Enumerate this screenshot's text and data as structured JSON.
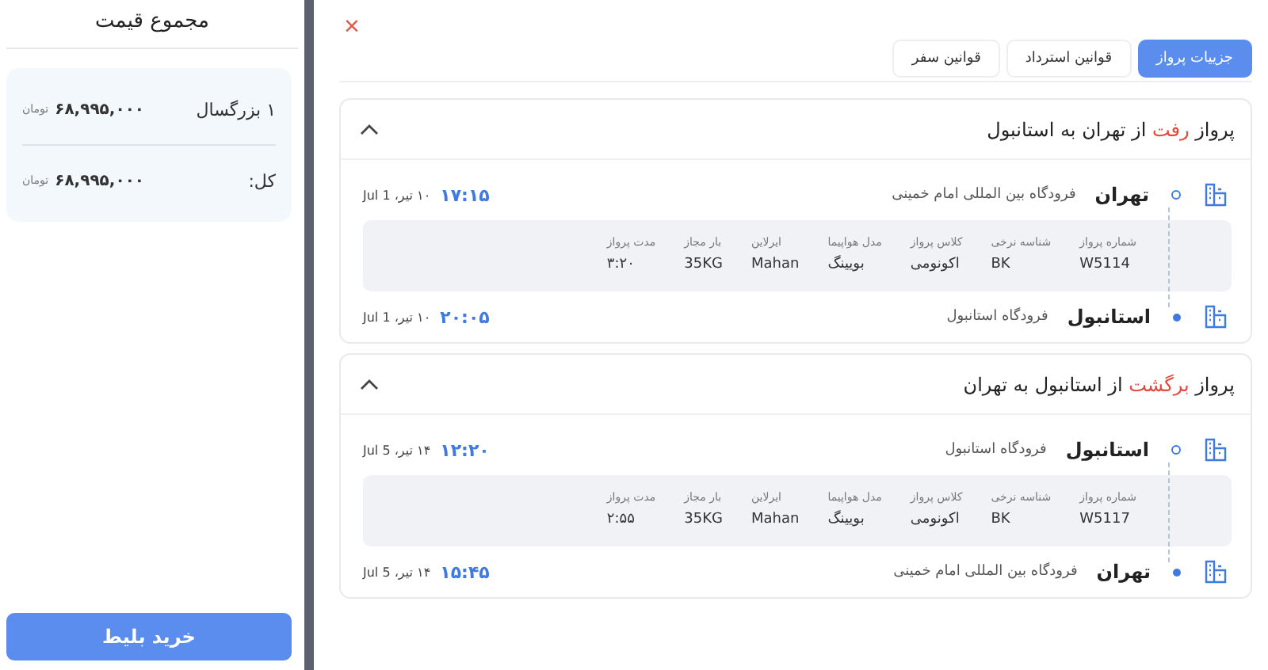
{
  "price_panel": {
    "title": "مجموع قیمت",
    "rows": [
      {
        "label": "۱ بزرگسال",
        "amount": "۶۸,۹۹۵,۰۰۰",
        "currency": "تومان"
      },
      {
        "label": "کل:",
        "amount": "۶۸,۹۹۵,۰۰۰",
        "currency": "تومان"
      }
    ],
    "buy_button": "خرید بلیط"
  },
  "close_button": "×",
  "tabs": [
    {
      "label": "جزییات پرواز",
      "selected": true
    },
    {
      "label": "قوانین استرداد",
      "selected": false
    },
    {
      "label": "قوانین سفر",
      "selected": false
    }
  ],
  "flights": [
    {
      "title": {
        "before": "پرواز",
        "highlight": "رفت",
        "after": "از تهران به استانبول"
      },
      "expanded": true,
      "stops": [
        {
          "kind": "departure",
          "city": "تهران",
          "airport": "فرودگاه بین المللی امام خمینی",
          "time": "۱۷:۱۵",
          "date": "۱۰ تیر، Jul 1"
        },
        {
          "kind": "arrival",
          "city": "استانبول",
          "airport": "فرودگاه استانبول",
          "time": "۲۰:۰۵",
          "date": "۱۰ تیر، Jul 1"
        }
      ],
      "details": [
        {
          "label": "شماره پرواز",
          "value": "W5114"
        },
        {
          "label": "شناسه نرخی",
          "value": "BK"
        },
        {
          "label": "کلاس پرواز",
          "value": "اکونومی"
        },
        {
          "label": "مدل هواپیما",
          "value": "بویینگ"
        },
        {
          "label": "ایرلاین",
          "value": "Mahan"
        },
        {
          "label": "بار مجاز",
          "value": "35KG"
        },
        {
          "label": "مدت پرواز",
          "value": "۳:۲۰"
        }
      ]
    },
    {
      "title": {
        "before": "پرواز",
        "highlight": "برگشت",
        "after": "از استانبول به تهران"
      },
      "expanded": true,
      "stops": [
        {
          "kind": "departure",
          "city": "استانبول",
          "airport": "فرودگاه استانبول",
          "time": "۱۲:۲۰",
          "date": "۱۴ تیر، Jul 5"
        },
        {
          "kind": "arrival",
          "city": "تهران",
          "airport": "فرودگاه بین المللی امام خمینی",
          "time": "۱۵:۴۵",
          "date": "۱۴ تیر، Jul 5"
        }
      ],
      "details": [
        {
          "label": "شماره پرواز",
          "value": "W5117"
        },
        {
          "label": "شناسه نرخی",
          "value": "BK"
        },
        {
          "label": "کلاس پرواز",
          "value": "اکونومی"
        },
        {
          "label": "مدل هواپیما",
          "value": "بویینگ"
        },
        {
          "label": "ایرلاین",
          "value": "Mahan"
        },
        {
          "label": "بار مجاز",
          "value": "35KG"
        },
        {
          "label": "مدت پرواز",
          "value": "۲:۵۵"
        }
      ]
    }
  ]
}
